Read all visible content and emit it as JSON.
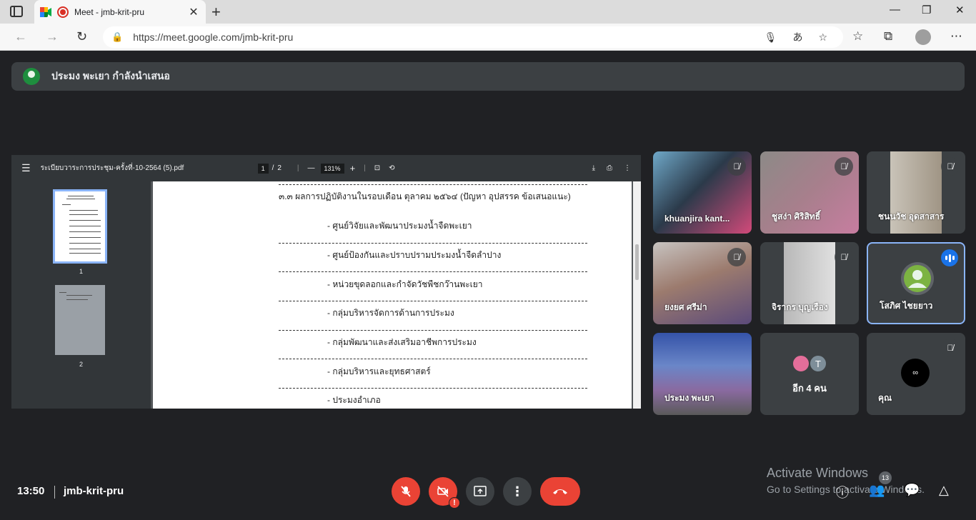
{
  "browser": {
    "tab_title": "Meet - jmb-krit-pru",
    "tab_close": "✕",
    "new_tab": "+",
    "url": "https://meet.google.com/jmb-krit-pru",
    "window_controls": [
      "—",
      "❐",
      "✕"
    ]
  },
  "banner": {
    "text": "ประมง พะเยา กำลังนำเสนอ"
  },
  "pdf": {
    "filename": "ระเบียบวาระการประชุม-ครั้งที่-10-2564 (5).pdf",
    "page_current": "1",
    "page_sep": "/",
    "page_total": "2",
    "zoom": "131%",
    "thumbs": [
      "1",
      "2"
    ],
    "heading": "๓.๓ ผลการปฏิบัติงานในรอบเดือน ตุลาคม ๒๕๖๔ (ปัญหา อุปสรรค ข้อเสนอแนะ)",
    "items": [
      "- ศูนย์วิจัยและพัฒนาประมงน้ำจืดพะเยา",
      "- ศูนย์ป้องกันและปราบปรามประมงน้ำจืดลำปาง",
      "- หน่วยขุดลอกและกำจัดวัชพืชกว๊านพะเยา",
      "- กลุ่มบริหารจัดการด้านการประมง",
      "- กลุ่มพัฒนาและส่งเสริมอาชีพการประมง",
      "- กลุ่มบริหารและยุทธศาสตร์",
      "- ประมงอำเภอ"
    ]
  },
  "participants": [
    {
      "name": "khuanjira kant...",
      "muted": true
    },
    {
      "name": "ชูสง่า ศิริสิทธิ์",
      "muted": true
    },
    {
      "name": "ชนนวัช อุดสาสาร",
      "muted": true
    },
    {
      "name": "ยงยศ ศรีม่า",
      "muted": true
    },
    {
      "name": "จิรากร บุญเรือง",
      "muted": true
    },
    {
      "name": "โสภิศ ไชยยาว",
      "muted": false,
      "speaking": true
    },
    {
      "name": "ประมง พะเยา",
      "muted": false
    },
    {
      "name": "อีก 4 คน",
      "muted": false,
      "avatars": [
        "",
        "T"
      ]
    },
    {
      "name": "คุณ",
      "muted": true
    }
  ],
  "bottom": {
    "time": "13:50",
    "meeting_code": "jmb-krit-pru",
    "people_count": "13",
    "camera_alert": "!"
  },
  "watermark": {
    "line1": "Activate Windows",
    "line2": "Go to Settings to activate Windows."
  },
  "colors": {
    "meet_bg": "#202124",
    "end_call": "#ea4335",
    "accent_blue": "#1a73e8",
    "tile_bg": "#3c4043"
  }
}
